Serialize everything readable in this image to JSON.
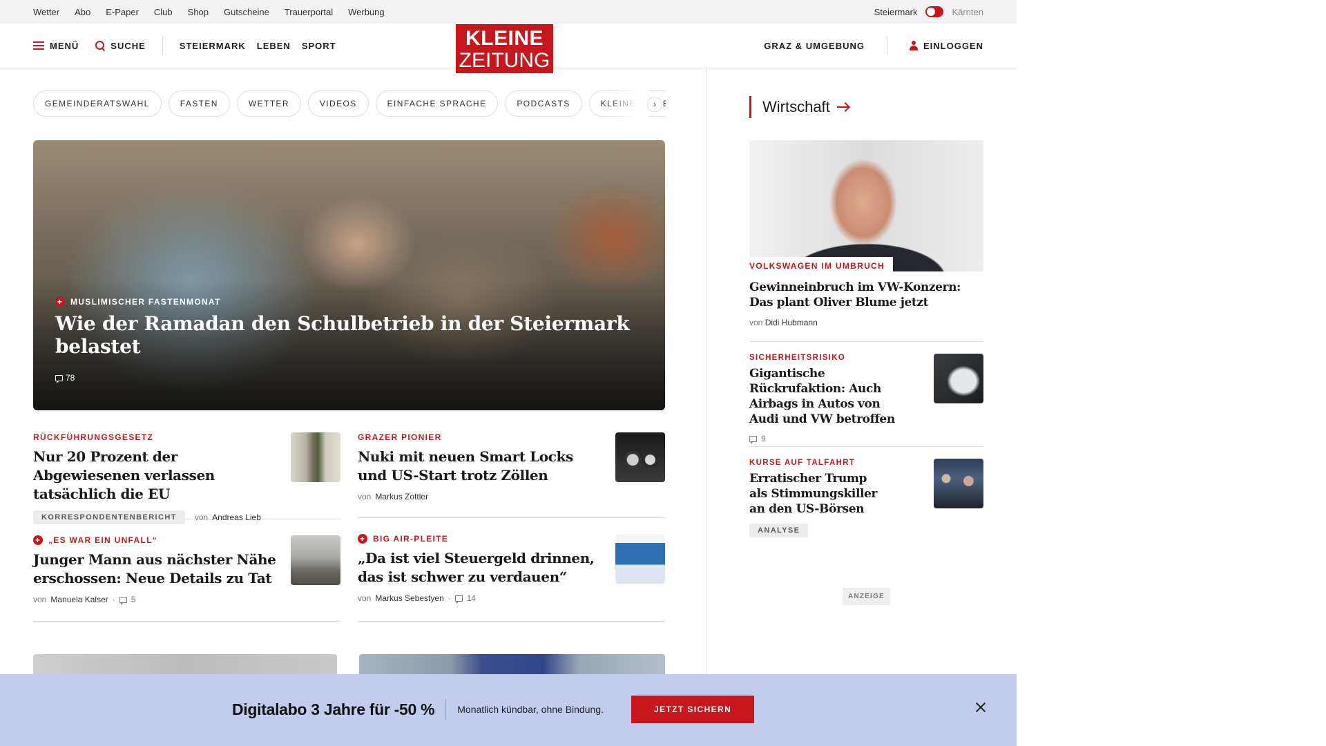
{
  "utility_bar": {
    "links": [
      "Wetter",
      "Abo",
      "E-Paper",
      "Club",
      "Shop",
      "Gutscheine",
      "Trauerportal",
      "Werbung"
    ],
    "region_active": "Steiermark",
    "region_inactive": "Kärnten"
  },
  "header": {
    "menu_label": "MENÜ",
    "search_label": "SUCHE",
    "nav": [
      "STEIERMARK",
      "LEBEN",
      "SPORT"
    ],
    "logo_line1": "KLEINE",
    "logo_line2": "ZEITUNG",
    "location_label": "GRAZ & UMGEBUNG",
    "login_label": "EINLOGGEN"
  },
  "chips": [
    "GEMEINDERATSWAHL",
    "FASTEN",
    "WETTER",
    "VIDEOS",
    "EINFACHE SPRACHE",
    "PODCASTS",
    "KLEINE KINDE"
  ],
  "chips_next_icon": "›",
  "hero": {
    "premium": true,
    "kicker": "MUSLIMISCHER FASTENMONAT",
    "title": "Wie der Ramadan den Schulbetrieb in der Steiermark belastet",
    "comments": "78"
  },
  "teasers": [
    {
      "kicker": "RÜCKFÜHRUNGSGESETZ",
      "title": "Nur 20 Prozent der Abgewiesenen verlassen tatsächlich die EU",
      "tag": "KORRESPONDENTENBERICHT",
      "by": "von",
      "author": "Andreas Lieb"
    },
    {
      "kicker": "GRAZER PIONIER",
      "title": "Nuki mit neuen Smart Locks und US-Start trotz Zöllen",
      "by": "von",
      "author": "Markus Zottler"
    },
    {
      "premium": true,
      "kicker": "„ES WAR EIN UNFALL“",
      "title": "Junger Mann aus nächster Nähe erschossen: Neue Details zu Tat",
      "by": "von",
      "author": "Manuela Kalser",
      "comments": "5"
    },
    {
      "premium": true,
      "kicker": "BIG AIR-PLEITE",
      "title": "„Da ist viel Steuergeld drinnen, das ist schwer zu verdauen“",
      "by": "von",
      "author": "Markus Sebestyen",
      "comments": "14"
    }
  ],
  "sidebar": {
    "section_title": "Wirtschaft",
    "lead": {
      "kicker": "VOLKSWAGEN IM UMBRUCH",
      "title": "Gewinneinbruch im VW-Konzern: Das plant Oliver Blume jetzt",
      "by": "von",
      "author": "Didi Hubmann"
    },
    "items": [
      {
        "kicker": "SICHERHEITSRISIKO",
        "title": "Gigantische Rückrufaktion: Auch Airbags in Autos von Audi und VW betroffen",
        "comments": "9"
      },
      {
        "kicker": "KURSE AUF TALFAHRT",
        "title": "Erratischer Trump als Stimmungskiller an den US-Börsen",
        "tag": "ANALYSE"
      }
    ],
    "ad_label": "ANZEIGE"
  },
  "promo": {
    "title": "Digitalabo 3 Jahre für -50 %",
    "subtitle": "Monatlich kündbar, ohne Bindung.",
    "cta": "JETZT SICHERN"
  },
  "colors": {
    "brand_red": "#c8161d",
    "promo_bg": "#c4cced",
    "utility_bg": "#f3f3f3"
  }
}
